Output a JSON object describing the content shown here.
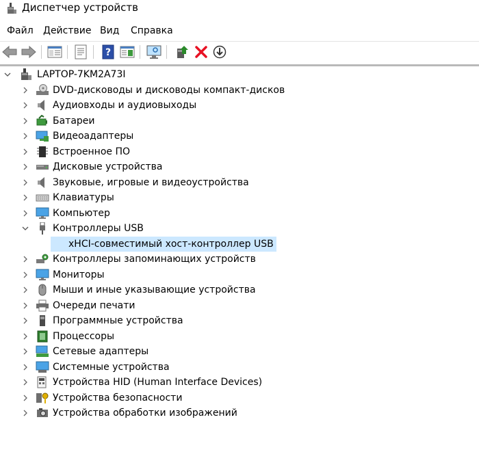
{
  "window": {
    "title": "Диспетчер устройств",
    "icon": "device-manager-icon"
  },
  "menu": [
    "Файл",
    "Действие",
    "Вид",
    "Справка"
  ],
  "toolbar": {
    "buttons": [
      "back-icon",
      "forward-icon",
      "properties-panel-icon",
      "properties-icon",
      "help-icon",
      "view-panel-icon",
      "scan-hardware-icon",
      "update-driver-icon",
      "uninstall-icon",
      "download-icon"
    ]
  },
  "tree": {
    "root": {
      "label": "LAPTOP-7KM2A73I",
      "icon": "computer-tower-icon",
      "expanded": true
    },
    "items": [
      {
        "label": "DVD-дисководы и дисководы компакт-дисков",
        "icon": "dvd-drive-icon",
        "expanded": false
      },
      {
        "label": "Аудиовходы и аудиовыходы",
        "icon": "speaker-icon",
        "expanded": false
      },
      {
        "label": "Батареи",
        "icon": "battery-icon",
        "expanded": false
      },
      {
        "label": "Видеоадаптеры",
        "icon": "display-adapter-icon",
        "expanded": false
      },
      {
        "label": "Встроенное ПО",
        "icon": "firmware-chip-icon",
        "expanded": false
      },
      {
        "label": "Дисковые устройства",
        "icon": "disk-drive-icon",
        "expanded": false
      },
      {
        "label": "Звуковые, игровые и видеоустройства",
        "icon": "speaker-icon",
        "expanded": false
      },
      {
        "label": "Клавиатуры",
        "icon": "keyboard-icon",
        "expanded": false
      },
      {
        "label": "Компьютер",
        "icon": "monitor-icon",
        "expanded": false
      },
      {
        "label": "Контроллеры USB",
        "icon": "usb-plug-icon",
        "expanded": true,
        "children": [
          {
            "label": "xHCI-совместимый хост-контроллер USB",
            "icon": "usb-warning-icon",
            "selected": true
          }
        ]
      },
      {
        "label": "Контроллеры запоминающих устройств",
        "icon": "storage-controller-icon",
        "expanded": false
      },
      {
        "label": "Мониторы",
        "icon": "monitor-icon",
        "expanded": false
      },
      {
        "label": "Мыши и иные указывающие устройства",
        "icon": "mouse-icon",
        "expanded": false
      },
      {
        "label": "Очереди печати",
        "icon": "printer-icon",
        "expanded": false
      },
      {
        "label": "Программные устройства",
        "icon": "software-device-icon",
        "expanded": false
      },
      {
        "label": "Процессоры",
        "icon": "processor-icon",
        "expanded": false
      },
      {
        "label": "Сетевые адаптеры",
        "icon": "network-adapter-icon",
        "expanded": false
      },
      {
        "label": "Системные устройства",
        "icon": "system-device-icon",
        "expanded": false
      },
      {
        "label": "Устройства HID (Human Interface Devices)",
        "icon": "hid-icon",
        "expanded": false
      },
      {
        "label": "Устройства безопасности",
        "icon": "security-key-icon",
        "expanded": false
      },
      {
        "label": "Устройства обработки изображений",
        "icon": "camera-icon",
        "expanded": false
      }
    ]
  },
  "colors": {
    "selection": "#cce8ff",
    "warning": "#f2c200",
    "delete": "#e81123",
    "update": "#2a8a2a"
  }
}
